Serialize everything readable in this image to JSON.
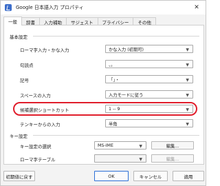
{
  "window": {
    "title": "Google 日本語入力 プロパティ"
  },
  "tabs": [
    "一般",
    "辞書",
    "入力補助",
    "サジェスト",
    "プライバシー",
    "その他"
  ],
  "basic": {
    "header": "基本設定",
    "romaji_label": "ローマ字入力・かな入力",
    "romaji_value": "かな入力 (初期可)",
    "punct_label": "句読点",
    "punct_value": "、。",
    "symbol_label": "記号",
    "symbol_value": "「」・",
    "space_label": "スペースの入力",
    "space_value": "入力モードに従う",
    "candidate_label": "候補選択ショートカット",
    "candidate_value": "1 -- 9",
    "tenkey_label": "テンキーからの入力",
    "tenkey_value": "半角"
  },
  "keys": {
    "header": "キー設定",
    "keymap_label": "キー設定の選択",
    "keymap_value": "MS-IME",
    "keymap_edit": "編集...",
    "romaji_table_label": "ローマ字テーブル",
    "romaji_table_edit": "編集..."
  },
  "footer": {
    "reset": "初期値に戻す",
    "ok": "OK",
    "cancel": "キャンセル",
    "apply": "適用"
  }
}
